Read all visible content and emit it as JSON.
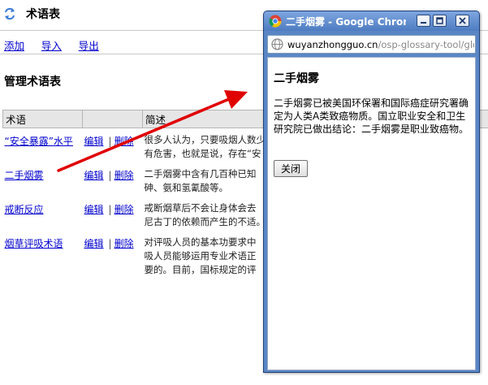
{
  "page": {
    "title": "术语表",
    "toolbar": {
      "add": "添加",
      "import": "导入",
      "export": "导出"
    },
    "section_title": "管理术语表"
  },
  "table": {
    "headers": {
      "term": "术语",
      "ops": "",
      "desc": "简述"
    },
    "edit_label": "编辑",
    "delete_label": "删除",
    "rows": [
      {
        "term": "“安全暴露”水平",
        "desc_line1": "很多人认为，只要吸烟人数少",
        "desc_line2": "有危害，也就是说，存在“安"
      },
      {
        "term": "二手烟雾",
        "desc_line1": "二手烟雾中含有几百种已知",
        "desc_line2": "砷、氨和氢氰酸等。"
      },
      {
        "term": "戒断反应",
        "desc_line1": "戒断烟草后不会让身体会去",
        "desc_line2": "尼古丁的依赖而产生的不适。"
      },
      {
        "term": "烟草评吸术语",
        "desc_line1": "对评吸人员的基本功要求中",
        "desc_line2": "吸人员能够运用专业术语正",
        "desc_line3": "要的。目前，国标规定的评"
      }
    ]
  },
  "popup": {
    "window_title": "二手烟雾 - Google Chrome",
    "url_host": "wuyanzhongguo.cn",
    "url_path": "/osp-glossary-tool/glossary",
    "heading": "二手烟雾",
    "body": "二手烟雾已被美国环保署和国际癌症研究署确定为人类A类致癌物质。国立职业安全和卫生研究院已做出结论：二手烟雾是职业致癌物。",
    "close_label": "关闭"
  },
  "colors": {
    "link": "#0000cc",
    "titlebar": "#5a86c5",
    "arrow": "#e00000"
  }
}
